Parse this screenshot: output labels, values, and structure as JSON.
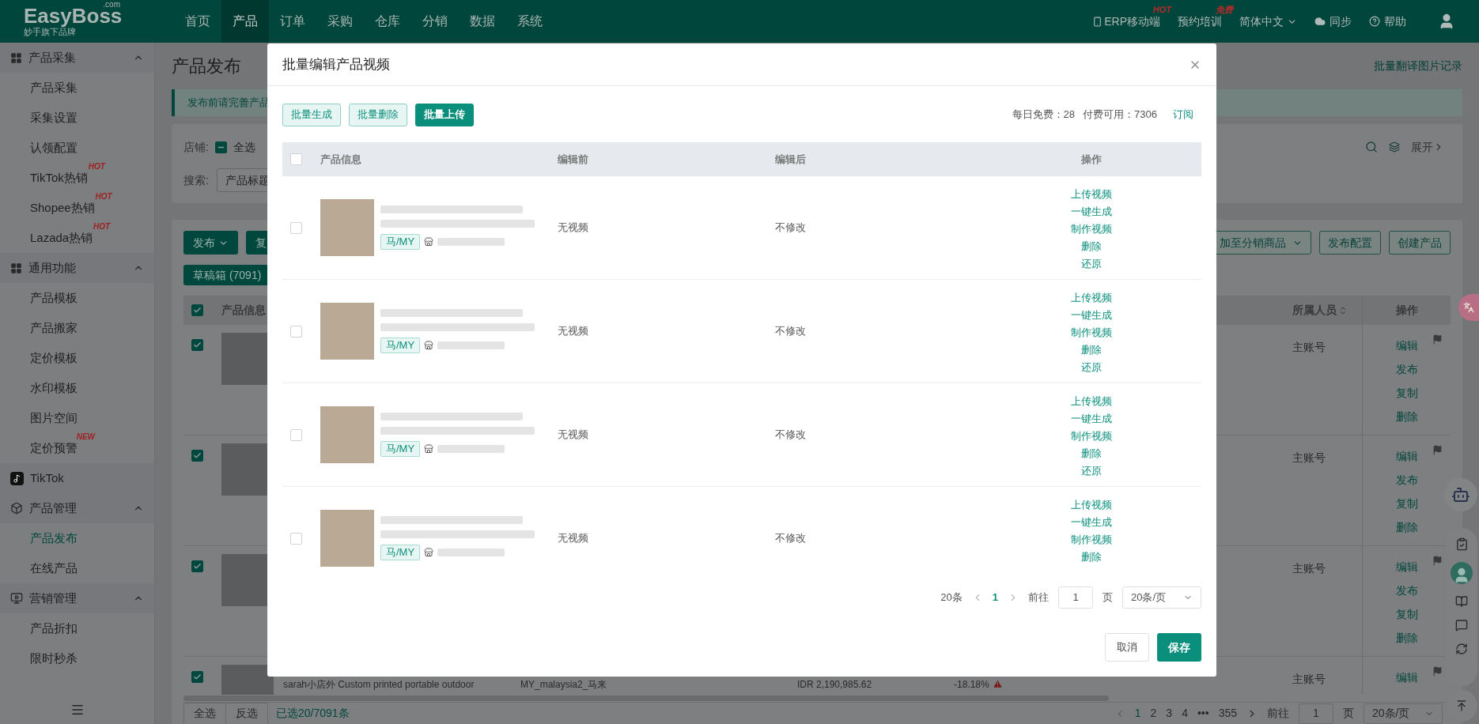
{
  "nav": {
    "logo": "EasyBoss",
    "logo_suffix": ".com",
    "tagline": "妙手旗下品牌",
    "menu": [
      {
        "label": "首页",
        "selected": false
      },
      {
        "label": "产品",
        "selected": true
      },
      {
        "label": "订单",
        "selected": false
      },
      {
        "label": "采购",
        "selected": false
      },
      {
        "label": "仓库",
        "selected": false
      },
      {
        "label": "分销",
        "selected": false
      },
      {
        "label": "数据",
        "selected": false
      },
      {
        "label": "系统",
        "selected": false
      }
    ],
    "right": [
      {
        "kind": "mobile",
        "label": "ERP移动端",
        "badge": "HOT"
      },
      {
        "kind": "plain",
        "label": "预约培训",
        "badge": "免费"
      },
      {
        "kind": "dropdown",
        "label": "简体中文"
      },
      {
        "kind": "sync",
        "label": "同步"
      },
      {
        "kind": "help",
        "label": "帮助"
      },
      {
        "kind": "user"
      }
    ]
  },
  "sidebar": {
    "sections": [
      {
        "title": "产品采集",
        "expanded": true,
        "items": [
          {
            "label": "产品采集",
            "selected": false
          },
          {
            "label": "采集设置",
            "selected": false
          },
          {
            "label": "认领配置",
            "selected": false
          },
          {
            "label": "TikTok热销",
            "badge": "HOT",
            "selected": false
          },
          {
            "label": "Shopee热销",
            "badge": "HOT",
            "selected": false
          },
          {
            "label": "Lazada热销",
            "badge": "HOT",
            "selected": false
          }
        ]
      },
      {
        "title": "通用功能",
        "expanded": true,
        "items": [
          {
            "label": "产品模板",
            "selected": false
          },
          {
            "label": "产品搬家",
            "selected": false
          },
          {
            "label": "定价模板",
            "selected": false
          },
          {
            "label": "水印模板",
            "selected": false
          },
          {
            "label": "图片空间",
            "selected": false
          },
          {
            "label": "定价预警",
            "badge": "NEW",
            "selected": false
          }
        ]
      },
      {
        "title": "TikTok"
      },
      {
        "title": "产品管理",
        "expanded": true,
        "items": [
          {
            "label": "产品发布",
            "selected": true
          },
          {
            "label": "在线产品",
            "selected": false
          }
        ]
      },
      {
        "title": "营销管理",
        "expanded": true,
        "items": [
          {
            "label": "产品折扣",
            "selected": false
          },
          {
            "label": "限时秒杀",
            "selected": false
          }
        ]
      }
    ]
  },
  "page": {
    "title": "产品发布",
    "link": "批量翻译图片记录",
    "notice": "发布前请完善产品",
    "filters": {
      "store_label": "店铺:",
      "select_all": {
        "label": "全选",
        "indeterminate": true
      },
      "search_label": "搜索:",
      "search_field": "产品标题",
      "expand": "展开"
    },
    "toolbar": {
      "left": [
        {
          "label": "发布",
          "dropdown": true
        },
        {
          "label": "复",
          "dropdown": false
        }
      ],
      "right": [
        {
          "label": "加至分销商品",
          "dropdown": true
        },
        {
          "label": "发布配置",
          "dropdown": false
        },
        {
          "label": "创建产品",
          "dropdown": false
        }
      ],
      "tab": "草稿箱 (7091)"
    },
    "table": {
      "select_all_checked": true,
      "columns": [
        {
          "label": "产品信息"
        },
        {
          "label": "所属人员",
          "sortable": true
        },
        {
          "label": "操作"
        }
      ],
      "rows": [
        {
          "checked": true,
          "owner": "主账号",
          "actions": [
            "编辑",
            "发布",
            "复制",
            "删除"
          ]
        },
        {
          "checked": true,
          "owner": "主账号",
          "actions": [
            "编辑",
            "发布",
            "复制",
            "删除"
          ]
        },
        {
          "checked": true,
          "owner": "主账号",
          "actions": [
            "编辑",
            "发布",
            "复制",
            "删除"
          ]
        },
        {
          "checked": true,
          "title": "sarah小店外 Custom printed portable outdoor",
          "store": "MY_malaysia2_马来",
          "price": "IDR 2,190,985.62",
          "change": "-18.18%",
          "owner": "主账号",
          "actions": [
            "编辑"
          ]
        }
      ]
    },
    "bottom": {
      "select_all": "全选",
      "invert": "反选",
      "selected": "已选20/7091条",
      "pages": [
        {
          "label": "1",
          "selected": true
        },
        {
          "label": "2",
          "selected": false
        },
        {
          "label": "3",
          "selected": false
        },
        {
          "label": "4",
          "selected": false
        },
        {
          "label": "•••",
          "selected": false
        },
        {
          "label": "355",
          "selected": false
        }
      ],
      "goto": "前往",
      "page_input": "1",
      "page_unit": "页",
      "page_size": "20条/页"
    }
  },
  "modal": {
    "title": "批量编辑产品视频",
    "buttons": [
      {
        "label": "批量生成",
        "kind": "outline"
      },
      {
        "label": "批量删除",
        "kind": "outline"
      },
      {
        "label": "批量上传",
        "kind": "primary"
      }
    ],
    "free": "每日免费：28",
    "paid": "付费可用：7306",
    "subscribe": "订阅",
    "table": {
      "select_all_checked": false,
      "columns": [
        "产品信息",
        "编辑前",
        "编辑后",
        "操作"
      ],
      "rows": [
        {
          "checked": false,
          "tag": "马/MY",
          "before": "无视频",
          "after": "不修改",
          "actions": [
            "上传视频",
            "一键生成",
            "制作视频",
            "删除",
            "还原"
          ]
        },
        {
          "checked": false,
          "tag": "马/MY",
          "before": "无视频",
          "after": "不修改",
          "actions": [
            "上传视频",
            "一键生成",
            "制作视频",
            "删除",
            "还原"
          ]
        },
        {
          "checked": false,
          "tag": "马/MY",
          "before": "无视频",
          "after": "不修改",
          "actions": [
            "上传视频",
            "一键生成",
            "制作视频",
            "删除",
            "还原"
          ]
        },
        {
          "checked": false,
          "tag": "马/MY",
          "before": "无视频",
          "after": "不修改",
          "actions": [
            "上传视频",
            "一键生成",
            "制作视频",
            "删除"
          ]
        }
      ]
    },
    "pagination": {
      "total": "20条",
      "pages": [
        {
          "label": "1",
          "selected": true
        }
      ],
      "goto": "前往",
      "page_input": "1",
      "page_unit": "页",
      "page_size": "20条/页"
    },
    "footer": {
      "cancel": "取消",
      "save": "保存"
    }
  }
}
